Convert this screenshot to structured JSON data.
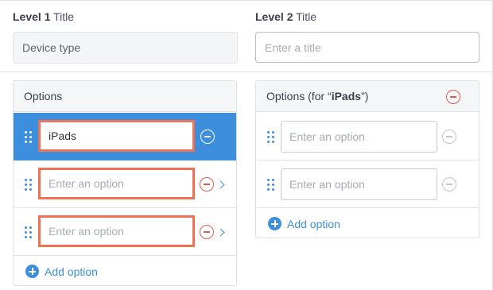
{
  "level1": {
    "label_bold": "Level 1",
    "label_rest": " Title",
    "value": "Device type"
  },
  "level2": {
    "label_bold": "Level 2",
    "label_rest": " Title",
    "placeholder": "Enter a title"
  },
  "options_panel": {
    "header": "Options",
    "items": [
      {
        "value": "iPads",
        "placeholder": "Enter an option",
        "selected": true
      },
      {
        "value": "",
        "placeholder": "Enter an option",
        "selected": false
      },
      {
        "value": "",
        "placeholder": "Enter an option",
        "selected": false
      }
    ],
    "add_label": "Add option"
  },
  "sub_panel": {
    "header_prefix": "Options (for “",
    "header_parent": "iPads",
    "header_suffix": "”)",
    "items": [
      {
        "value": "",
        "placeholder": "Enter an option"
      },
      {
        "value": "",
        "placeholder": "Enter an option"
      }
    ],
    "add_label": "Add option"
  },
  "colors": {
    "accent": "#3d8fde",
    "danger": "#e25a4f",
    "highlight": "#ef7352",
    "muted": "#c2c6cc"
  }
}
